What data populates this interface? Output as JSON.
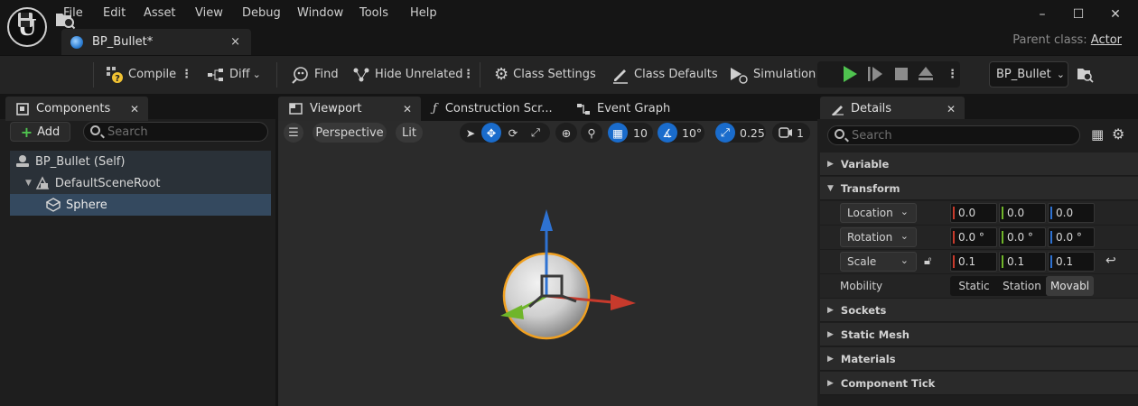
{
  "menu": [
    "File",
    "Edit",
    "Asset",
    "View",
    "Debug",
    "Window",
    "Tools",
    "Help"
  ],
  "document_tab": {
    "label": "BP_Bullet*",
    "close": "×"
  },
  "window_controls": {
    "minimize": "–",
    "maximize": "☐",
    "close": "✕"
  },
  "parent_class": {
    "label": "Parent class:",
    "value": "Actor"
  },
  "toolbar": {
    "compile": "Compile",
    "diff": "Diff",
    "find": "Find",
    "hide_unrelated": "Hide Unrelated",
    "class_settings": "Class Settings",
    "class_defaults": "Class Defaults",
    "simulation": "Simulation",
    "debug_object": "BP_Bullet"
  },
  "components": {
    "tab_label": "Components",
    "add_label": "Add",
    "search_placeholder": "Search",
    "tree": [
      {
        "label": "BP_Bullet (Self)"
      },
      {
        "label": "DefaultSceneRoot"
      },
      {
        "label": "Sphere"
      }
    ]
  },
  "editor_tabs": {
    "viewport": "Viewport",
    "construction": "Construction Scr...",
    "event_graph": "Event Graph"
  },
  "viewport": {
    "perspective": "Perspective",
    "lit": "Lit",
    "grid_snap": "10",
    "rotation_snap": "10°",
    "scale_snap": "0.25",
    "camera_speed": "1"
  },
  "details": {
    "tab_label": "Details",
    "search_placeholder": "Search",
    "categories": {
      "variable": "Variable",
      "transform": "Transform",
      "sockets": "Sockets",
      "static_mesh": "Static Mesh",
      "materials": "Materials",
      "component_tick": "Component Tick"
    },
    "location": {
      "label": "Location",
      "x": "0.0",
      "y": "0.0",
      "z": "0.0"
    },
    "rotation": {
      "label": "Rotation",
      "x": "0.0 °",
      "y": "0.0 °",
      "z": "0.0 °"
    },
    "scale": {
      "label": "Scale",
      "x": "0.1",
      "y": "0.1",
      "z": "0.1"
    },
    "mobility": {
      "label": "Mobility",
      "static": "Static",
      "stationary": "Station",
      "movable": "Movabl"
    }
  },
  "colors": {
    "accent_blue": "#1a6ccc",
    "play_green": "#4fc34f",
    "selection": "#34495f",
    "axis_x": "#c73a2c",
    "axis_y": "#6fb52a",
    "axis_z": "#2e72d2"
  }
}
